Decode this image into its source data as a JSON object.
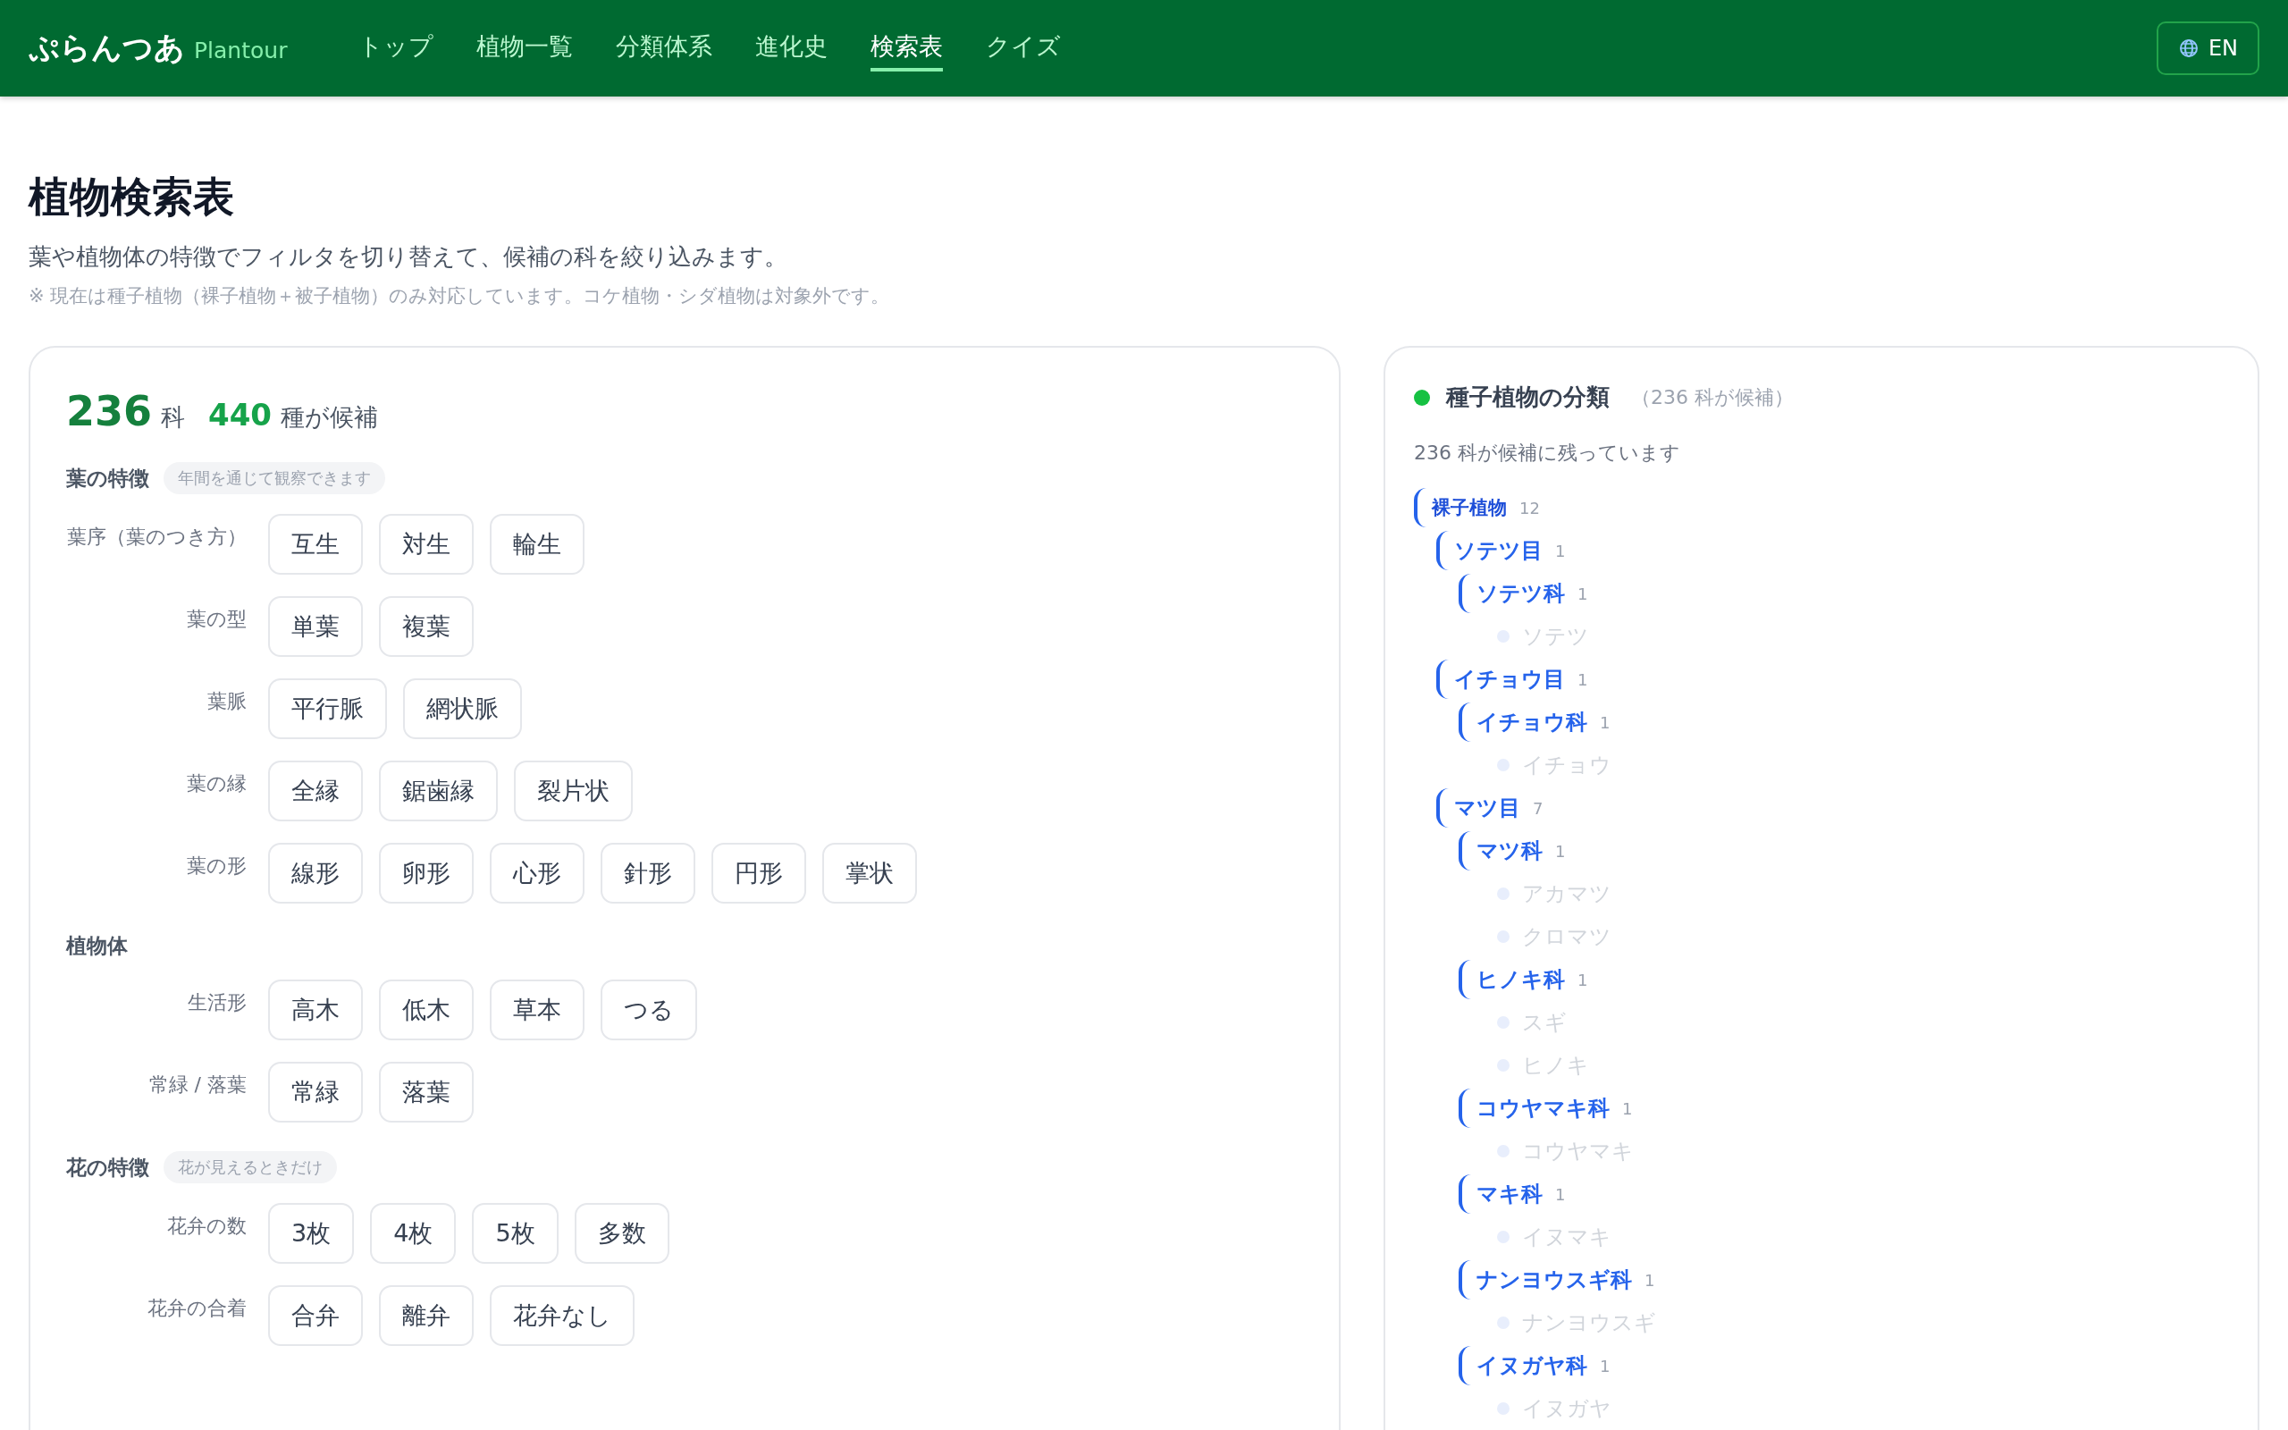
{
  "header": {
    "logo": "ぷらんつあ",
    "logo_sub": "Plantour",
    "nav": [
      {
        "label": "トップ",
        "selected": false
      },
      {
        "label": "植物一覧",
        "selected": false
      },
      {
        "label": "分類体系",
        "selected": false
      },
      {
        "label": "進化史",
        "selected": false
      },
      {
        "label": "検索表",
        "selected": true
      },
      {
        "label": "クイズ",
        "selected": false
      }
    ],
    "language_button": "EN"
  },
  "page": {
    "title": "植物検索表",
    "description": "葉や植物体の特徴でフィルタを切り替えて、候補の科を絞り込みます。",
    "note": "※ 現在は種子植物（裸子植物＋被子植物）のみ対応しています。コケ植物・シダ植物は対象外です。"
  },
  "filter_panel": {
    "family_count": "236",
    "family_unit": "科",
    "species_count": "440",
    "species_unit": "種が候補",
    "sections": [
      {
        "title": "葉の特徴",
        "tag": "年間を通じて観察できます",
        "rows": [
          {
            "label": "葉序（葉のつき方）",
            "chips": [
              "互生",
              "対生",
              "輪生"
            ]
          },
          {
            "label": "葉の型",
            "chips": [
              "単葉",
              "複葉"
            ]
          },
          {
            "label": "葉脈",
            "chips": [
              "平行脈",
              "網状脈"
            ]
          },
          {
            "label": "葉の縁",
            "chips": [
              "全縁",
              "鋸歯縁",
              "裂片状"
            ]
          },
          {
            "label": "葉の形",
            "chips": [
              "線形",
              "卵形",
              "心形",
              "針形",
              "円形",
              "掌状"
            ]
          }
        ]
      },
      {
        "title": "植物体",
        "rows": [
          {
            "label": "生活形",
            "chips": [
              "高木",
              "低木",
              "草本",
              "つる"
            ]
          },
          {
            "label": "常緑 / 落葉",
            "chips": [
              "常緑",
              "落葉"
            ]
          }
        ]
      },
      {
        "title": "花の特徴",
        "tag": "花が見えるときだけ",
        "rows": [
          {
            "label": "花弁の数",
            "chips": [
              "3枚",
              "4枚",
              "5枚",
              "多数"
            ]
          },
          {
            "label": "花弁の合着",
            "chips": [
              "合弁",
              "離弁",
              "花弁なし"
            ]
          }
        ]
      }
    ]
  },
  "tree_panel": {
    "title": "種子植物の分類",
    "count_note": "（236 科が候補）",
    "summary": "236 科が候補に残っています",
    "tree": [
      {
        "kind": "taxon",
        "name": "裸子植物",
        "count": "12",
        "children": [
          {
            "kind": "taxon",
            "name": "ソテツ目",
            "count": "1",
            "children": [
              {
                "kind": "taxon",
                "name": "ソテツ科",
                "count": "1",
                "children": [
                  {
                    "kind": "species",
                    "name": "ソテツ"
                  }
                ]
              }
            ]
          },
          {
            "kind": "taxon",
            "name": "イチョウ目",
            "count": "1",
            "children": [
              {
                "kind": "taxon",
                "name": "イチョウ科",
                "count": "1",
                "children": [
                  {
                    "kind": "species",
                    "name": "イチョウ"
                  }
                ]
              }
            ]
          },
          {
            "kind": "taxon",
            "name": "マツ目",
            "count": "7",
            "children": [
              {
                "kind": "taxon",
                "name": "マツ科",
                "count": "1",
                "children": [
                  {
                    "kind": "species",
                    "name": "アカマツ"
                  },
                  {
                    "kind": "species",
                    "name": "クロマツ"
                  }
                ]
              },
              {
                "kind": "taxon",
                "name": "ヒノキ科",
                "count": "1",
                "children": [
                  {
                    "kind": "species",
                    "name": "スギ"
                  },
                  {
                    "kind": "species",
                    "name": "ヒノキ"
                  }
                ]
              },
              {
                "kind": "taxon",
                "name": "コウヤマキ科",
                "count": "1",
                "children": [
                  {
                    "kind": "species",
                    "name": "コウヤマキ"
                  }
                ]
              },
              {
                "kind": "taxon",
                "name": "マキ科",
                "count": "1",
                "children": [
                  {
                    "kind": "species",
                    "name": "イヌマキ"
                  }
                ]
              },
              {
                "kind": "taxon",
                "name": "ナンヨウスギ科",
                "count": "1",
                "children": [
                  {
                    "kind": "species",
                    "name": "ナンヨウスギ"
                  }
                ]
              },
              {
                "kind": "taxon",
                "name": "イヌガヤ科",
                "count": "1",
                "children": [
                  {
                    "kind": "species",
                    "name": "イヌガヤ"
                  }
                ]
              }
            ]
          }
        ]
      }
    ]
  }
}
